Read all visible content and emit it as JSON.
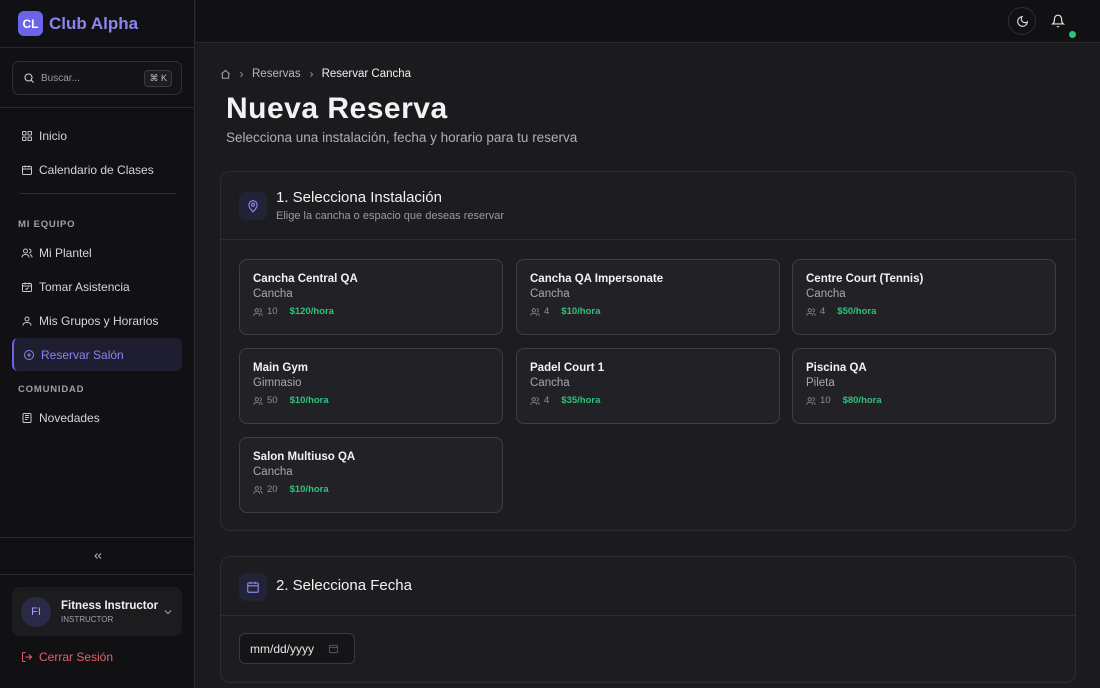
{
  "brand": {
    "logo": "CL",
    "name": "Club Alpha"
  },
  "search": {
    "placeholder": "Buscar...",
    "shortcut": "⌘ K"
  },
  "nav": {
    "main": [
      {
        "label": "Inicio",
        "icon": "grid-icon"
      },
      {
        "label": "Calendario de Clases",
        "icon": "calendar-icon"
      }
    ],
    "team_title": "MI EQUIPO",
    "team": [
      {
        "label": "Mi Plantel",
        "icon": "users-icon"
      },
      {
        "label": "Tomar Asistencia",
        "icon": "calendar-check-icon"
      },
      {
        "label": "Mis Grupos y Horarios",
        "icon": "user-icon"
      },
      {
        "label": "Reservar Salón",
        "icon": "plus-circle-icon",
        "active": true
      }
    ],
    "community_title": "COMUNIDAD",
    "community": [
      {
        "label": "Novedades",
        "icon": "newspaper-icon"
      }
    ]
  },
  "user": {
    "initials": "FI",
    "name": "Fitness Instructor",
    "role": "INSTRUCTOR"
  },
  "logout": {
    "label": "Cerrar Sesión"
  },
  "breadcrumb": {
    "parent": "Reservas",
    "current": "Reservar Cancha"
  },
  "page": {
    "title": "Nueva Reserva",
    "subtitle": "Selecciona una instalación, fecha y horario para tu reserva"
  },
  "step1": {
    "title": "1. Selecciona Instalación",
    "desc": "Elige la cancha o espacio que deseas reservar",
    "facilities": [
      {
        "name": "Cancha Central QA",
        "type": "Cancha",
        "capacity": "10",
        "price": "$120/hora"
      },
      {
        "name": "Cancha QA Impersonate",
        "type": "Cancha",
        "capacity": "4",
        "price": "$10/hora"
      },
      {
        "name": "Centre Court (Tennis)",
        "type": "Cancha",
        "capacity": "4",
        "price": "$50/hora"
      },
      {
        "name": "Main Gym",
        "type": "Gimnasio",
        "capacity": "50",
        "price": "$10/hora"
      },
      {
        "name": "Padel Court 1",
        "type": "Cancha",
        "capacity": "4",
        "price": "$35/hora"
      },
      {
        "name": "Piscina QA",
        "type": "Pileta",
        "capacity": "10",
        "price": "$80/hora"
      },
      {
        "name": "Salon Multiuso QA",
        "type": "Cancha",
        "capacity": "20",
        "price": "$10/hora"
      }
    ]
  },
  "step2": {
    "title": "2. Selecciona Fecha",
    "date_placeholder": "mm/dd/yyyy"
  },
  "colors": {
    "accent": "#6b63e8",
    "price": "#2ec27e",
    "logout": "#e8606a",
    "online": "#2ec27e"
  }
}
